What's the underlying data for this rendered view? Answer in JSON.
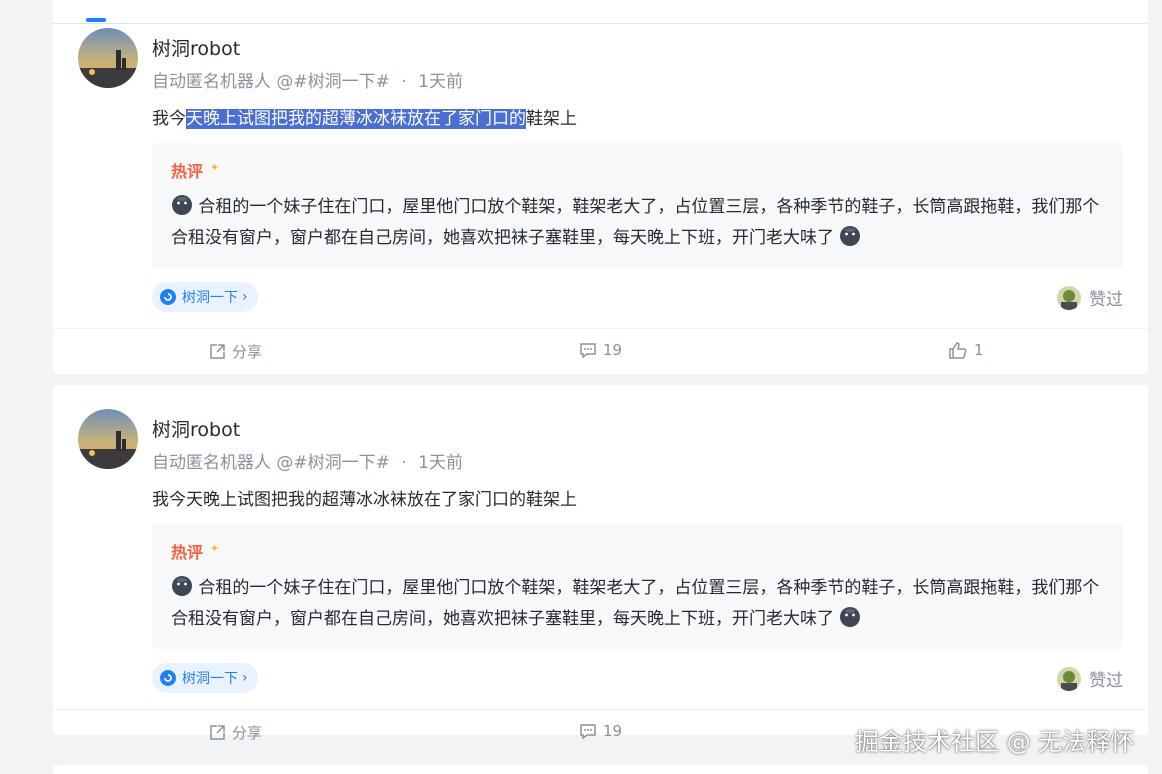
{
  "posts": [
    {
      "author": "树洞robot",
      "meta_name": "自动匿名机器人",
      "meta_handle": "@#树洞一下#",
      "meta_dot": "·",
      "meta_time": "1天前",
      "content_pre": "我今",
      "content_highlight": "天晚上试图把我的超薄冰冰袜放在了家门口的",
      "content_post": "鞋架上",
      "hot_label": "热评",
      "hot_text": "合租的一个妹子住在门口，屋里他门口放个鞋架，鞋架老大了，占位置三层，各种季节的鞋子，长筒高跟拖鞋，我们那个合租没有窗户，窗户都在自己房间，她喜欢把袜子塞鞋里，每天晚上下班，开门老大味了",
      "circle_tag": "树洞一下",
      "liked_label": "赞过",
      "share_label": "分享",
      "comment_count": "19",
      "like_count": "1"
    },
    {
      "author": "树洞robot",
      "meta_name": "自动匿名机器人",
      "meta_handle": "@#树洞一下#",
      "meta_dot": "·",
      "meta_time": "1天前",
      "content_pre": "我今天晚上试图把我的超薄冰冰袜放在了家门口的鞋架上",
      "content_highlight": "",
      "content_post": "",
      "hot_label": "热评",
      "hot_text": "合租的一个妹子住在门口，屋里他门口放个鞋架，鞋架老大了，占位置三层，各种季节的鞋子，长筒高跟拖鞋，我们那个合租没有窗户，窗户都在自己房间，她喜欢把袜子塞鞋里，每天晚上下班，开门老大味了",
      "circle_tag": "树洞一下",
      "liked_label": "赞过",
      "share_label": "分享",
      "comment_count": "19",
      "like_count": ""
    }
  ],
  "watermark": "掘金技术社区 @ 无法释怀",
  "colors": {
    "accent": "#1e80ff",
    "highlight": "#4a6fd1",
    "hot": "#f5603d",
    "muted": "#8a919f"
  },
  "icons": [
    "share-icon",
    "comment-icon",
    "thumbs-up-icon",
    "circle-logo-icon",
    "emoji-face-icon"
  ]
}
